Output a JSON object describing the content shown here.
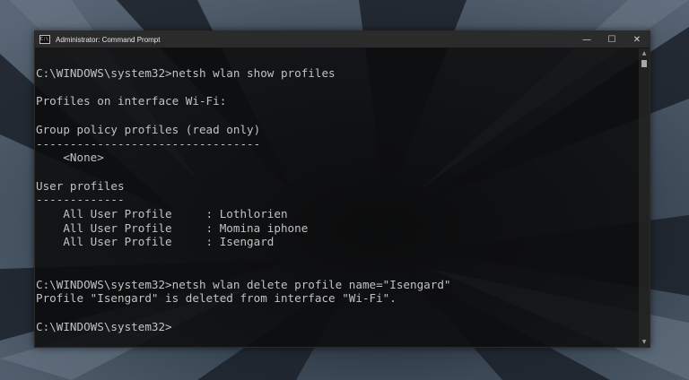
{
  "window": {
    "title": "Administrator: Command Prompt",
    "icon_name": "cmd-icon",
    "icon_glyph": "C:\\",
    "controls": {
      "minimize": "—",
      "maximize": "☐",
      "close": "✕"
    }
  },
  "console": {
    "lines": [
      "C:\\WINDOWS\\system32>netsh wlan show profiles",
      "",
      "Profiles on interface Wi-Fi:",
      "",
      "Group policy profiles (read only)",
      "---------------------------------",
      "    <None>",
      "",
      "User profiles",
      "-------------",
      "    All User Profile     : Lothlorien",
      "    All User Profile     : Momina iphone",
      "    All User Profile     : Isengard",
      "",
      "",
      "C:\\WINDOWS\\system32>netsh wlan delete profile name=\"Isengard\"",
      "Profile \"Isengard\" is deleted from interface \"Wi-Fi\".",
      "",
      "C:\\WINDOWS\\system32>"
    ]
  },
  "colors": {
    "console_bg": "#0c0c0c",
    "console_text": "#c2c2c2",
    "titlebar_bg": "#2b2b2b",
    "wallpaper": "#2f3a47"
  }
}
